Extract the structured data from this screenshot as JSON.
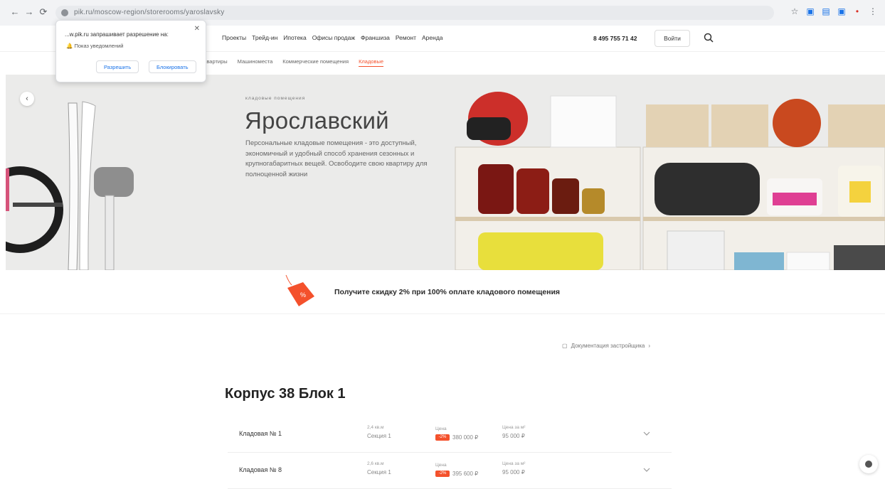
{
  "browser": {
    "url": "pik.ru/moscow-region/storerooms/yaroslavsky"
  },
  "permission_popup": {
    "text": "...w.pik.ru запрашивает разрешение на:",
    "permission": "Показ уведомлений",
    "allow": "Разрешить",
    "block": "Блокировать"
  },
  "header": {
    "nav": [
      "Проекты",
      "Трейд-ин",
      "Ипотека",
      "Офисы продаж",
      "Франшиза",
      "Ремонт",
      "Аренда"
    ],
    "phone": "8 495 755 71 42",
    "login": "Войти"
  },
  "subnav": {
    "items": [
      "Квартиры",
      "Машиноместа",
      "Коммерческие помещения",
      "Кладовые"
    ],
    "active": "Кладовые"
  },
  "hero": {
    "overline": "кладовые помещения",
    "title": "Ярославский",
    "description": "Персональные кладовые помещения - это доступный, экономичный и удобный способ хранения сезонных и крупногабаритных вещей. Освободите свою квартиру для полноценной жизни"
  },
  "promo": {
    "text": "Получите скидку 2% при 100% оплате кладового помещения",
    "tag": "%"
  },
  "docs_link": "Документация застройщика",
  "building": {
    "title": "Корпус 38 Блок 1",
    "rows": [
      {
        "name": "Кладовая № 1",
        "floor_label": "2,4 кв.м",
        "floor": "Секция 1",
        "price_label": "Цена",
        "badge": "-2%",
        "price": "380 000 ₽",
        "sqm_label": "Цена за м²",
        "sqm": "95 000 ₽"
      },
      {
        "name": "Кладовая № 8",
        "floor_label": "2,6 кв.м",
        "floor": "Секция 1",
        "price_label": "Цена",
        "badge": "-2%",
        "price": "395 600 ₽",
        "sqm_label": "Цена за м²",
        "sqm": "95 000 ₽"
      }
    ]
  },
  "colors": {
    "accent": "#f4512c",
    "hero_bg": "#ebebea"
  }
}
